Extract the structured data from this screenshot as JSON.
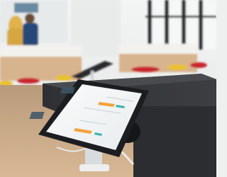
{
  "scene": {
    "kind": "photo",
    "subject": "tablet-kiosk-on-stand",
    "palette": {
      "wall": "#eef0f0",
      "window_frame": "#2b2f31",
      "floor": "#c9a783",
      "counter": "#3a3b3d",
      "counter_top": "#4a4b4e",
      "tablet_body": "#1c1d20",
      "screen": "#f4f6f7",
      "accent_orange": "#f2a33a",
      "accent_teal": "#3bb3b0",
      "chair_red": "#c8282f",
      "chair_yellow": "#e9c12a",
      "desk_white": "#f3f1ee",
      "desk_wood": "#d8b48e"
    }
  }
}
